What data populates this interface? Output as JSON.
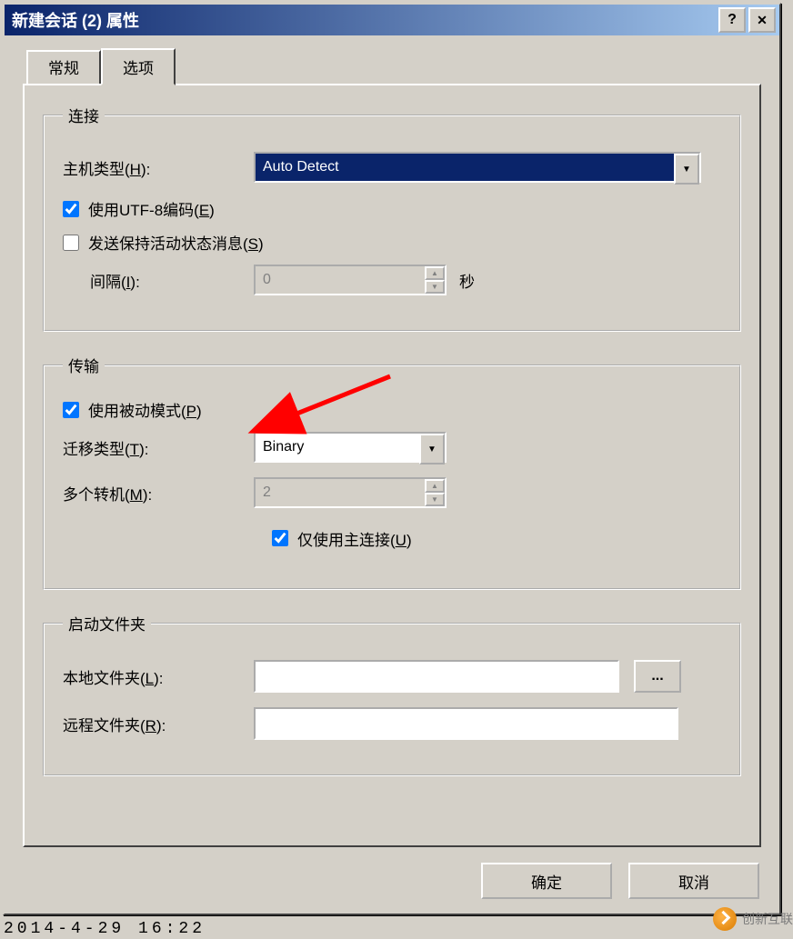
{
  "window": {
    "title": "新建会话 (2) 属性"
  },
  "tabs": {
    "general": "常规",
    "options": "选项"
  },
  "connection": {
    "legend": "连接",
    "host_type_label": "主机类型(",
    "host_type_key": "H",
    "host_type_label2": "):",
    "host_type_value": "Auto Detect",
    "use_utf8_label": "使用UTF-8编码(",
    "use_utf8_key": "E",
    "use_utf8_label2": ")",
    "keepalive_label": "发送保持活动状态消息(",
    "keepalive_key": "S",
    "keepalive_label2": ")",
    "interval_label": "间隔(",
    "interval_key": "I",
    "interval_label2": "):",
    "interval_value": "0",
    "seconds": "秒"
  },
  "transfer": {
    "legend": "传输",
    "passive_label": "使用被动模式(",
    "passive_key": "P",
    "passive_label2": ")",
    "transfer_type_label": "迁移类型(",
    "transfer_type_key": "T",
    "transfer_type_label2": "):",
    "transfer_type_value": "Binary",
    "multi_hop_label": "多个转机(",
    "multi_hop_key": "M",
    "multi_hop_label2": "):",
    "multi_hop_value": "2",
    "main_conn_label": "仅使用主连接(",
    "main_conn_key": "U",
    "main_conn_label2": ")"
  },
  "startup": {
    "legend": "启动文件夹",
    "local_label": "本地文件夹(",
    "local_key": "L",
    "local_label2": "):",
    "remote_label": "远程文件夹(",
    "remote_key": "R",
    "remote_label2": "):",
    "browse": "..."
  },
  "buttons": {
    "ok": "确定",
    "cancel": "取消"
  },
  "watermark": "创新互联",
  "footer_time": "2014-4-29 16:22"
}
